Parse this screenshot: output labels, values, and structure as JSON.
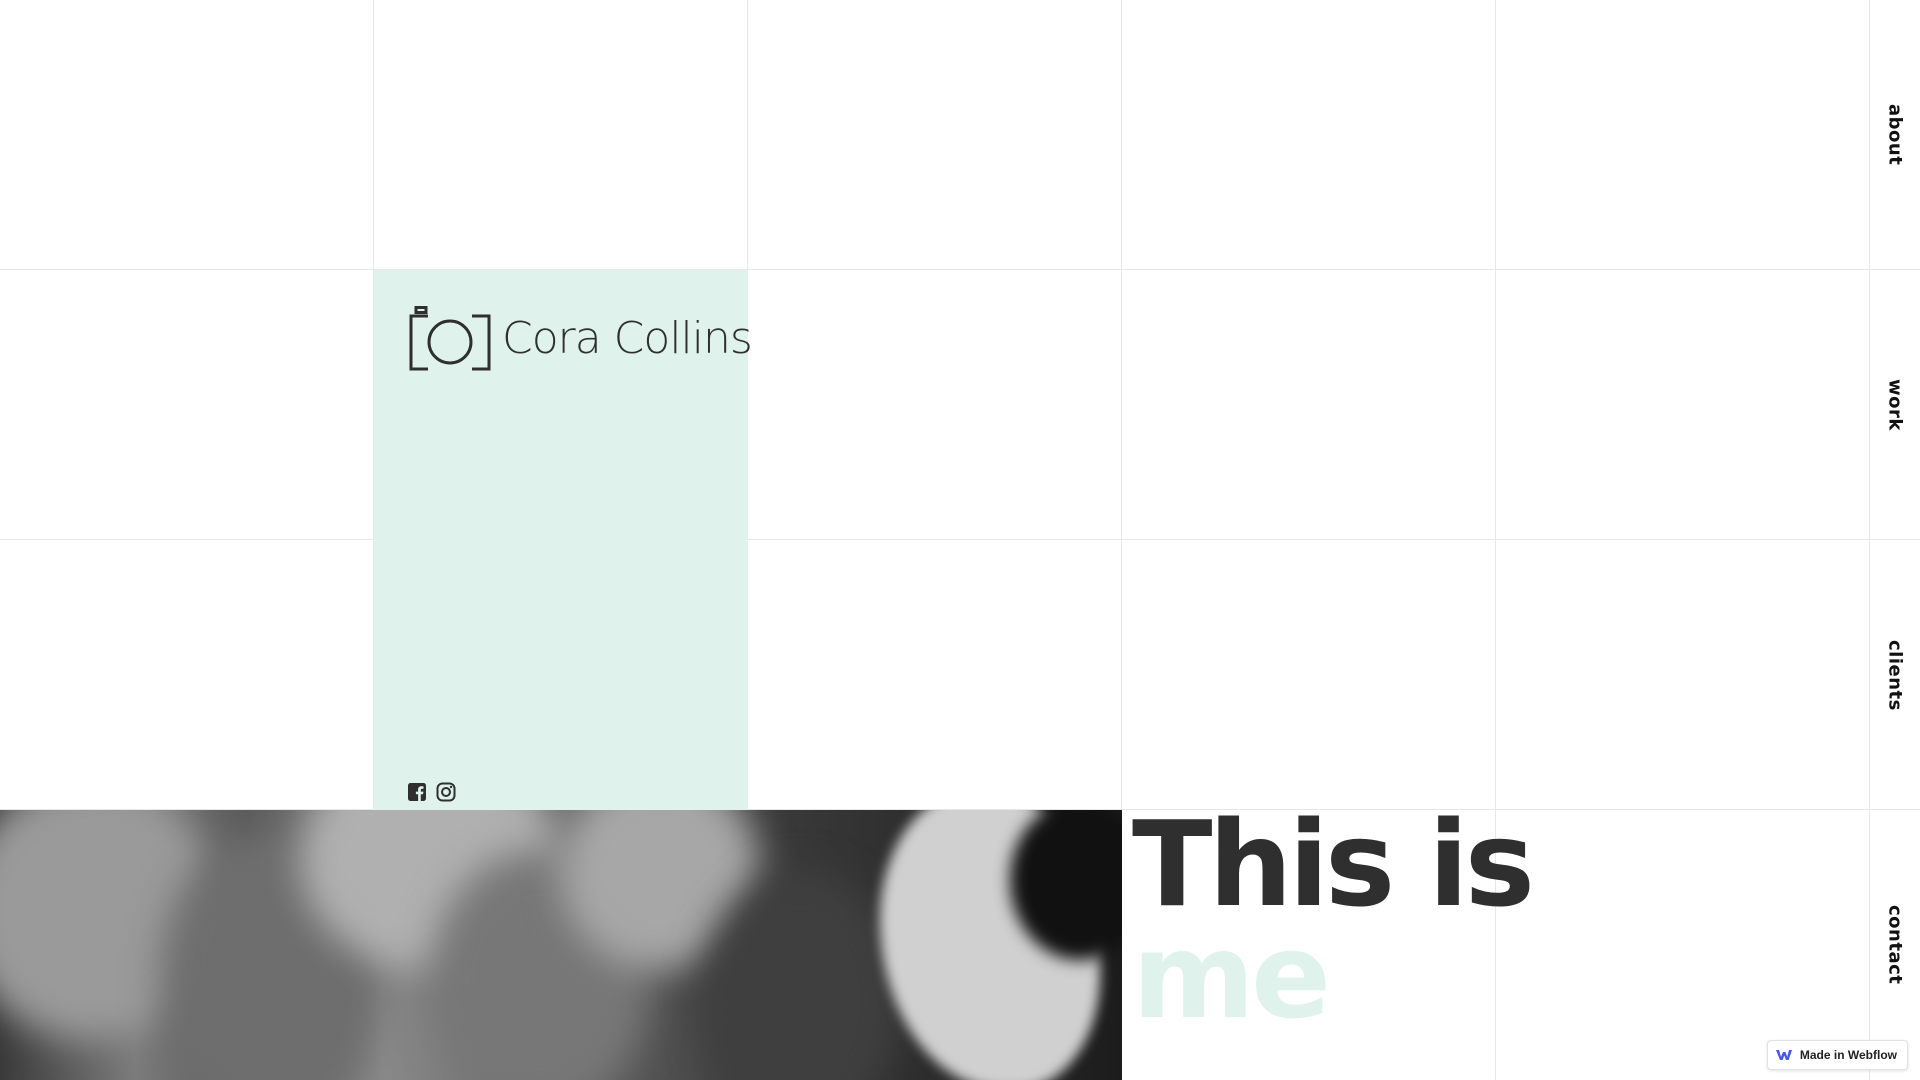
{
  "brand": {
    "name": "Cora Collins",
    "logo_icon": "camera-frame-icon",
    "panel_color": "#e0f2ec",
    "text_color": "#2f2f2f"
  },
  "socials": [
    {
      "name": "facebook",
      "icon": "facebook-icon"
    },
    {
      "name": "instagram",
      "icon": "instagram-icon"
    }
  ],
  "nav": {
    "items": [
      {
        "label": "about"
      },
      {
        "label": "work"
      },
      {
        "label": "clients"
      },
      {
        "label": "contact"
      }
    ]
  },
  "hero": {
    "line1": "This is",
    "line2": "me",
    "line1_color": "#2f2f2f",
    "line2_color": "#dff3ec",
    "photo": "black-and-white portrait photo"
  },
  "badge": {
    "label": "Made in Webflow",
    "icon": "webflow-logo-icon",
    "accent": "#4353ff"
  },
  "grid": {
    "line_color": "#e7e7e7"
  }
}
